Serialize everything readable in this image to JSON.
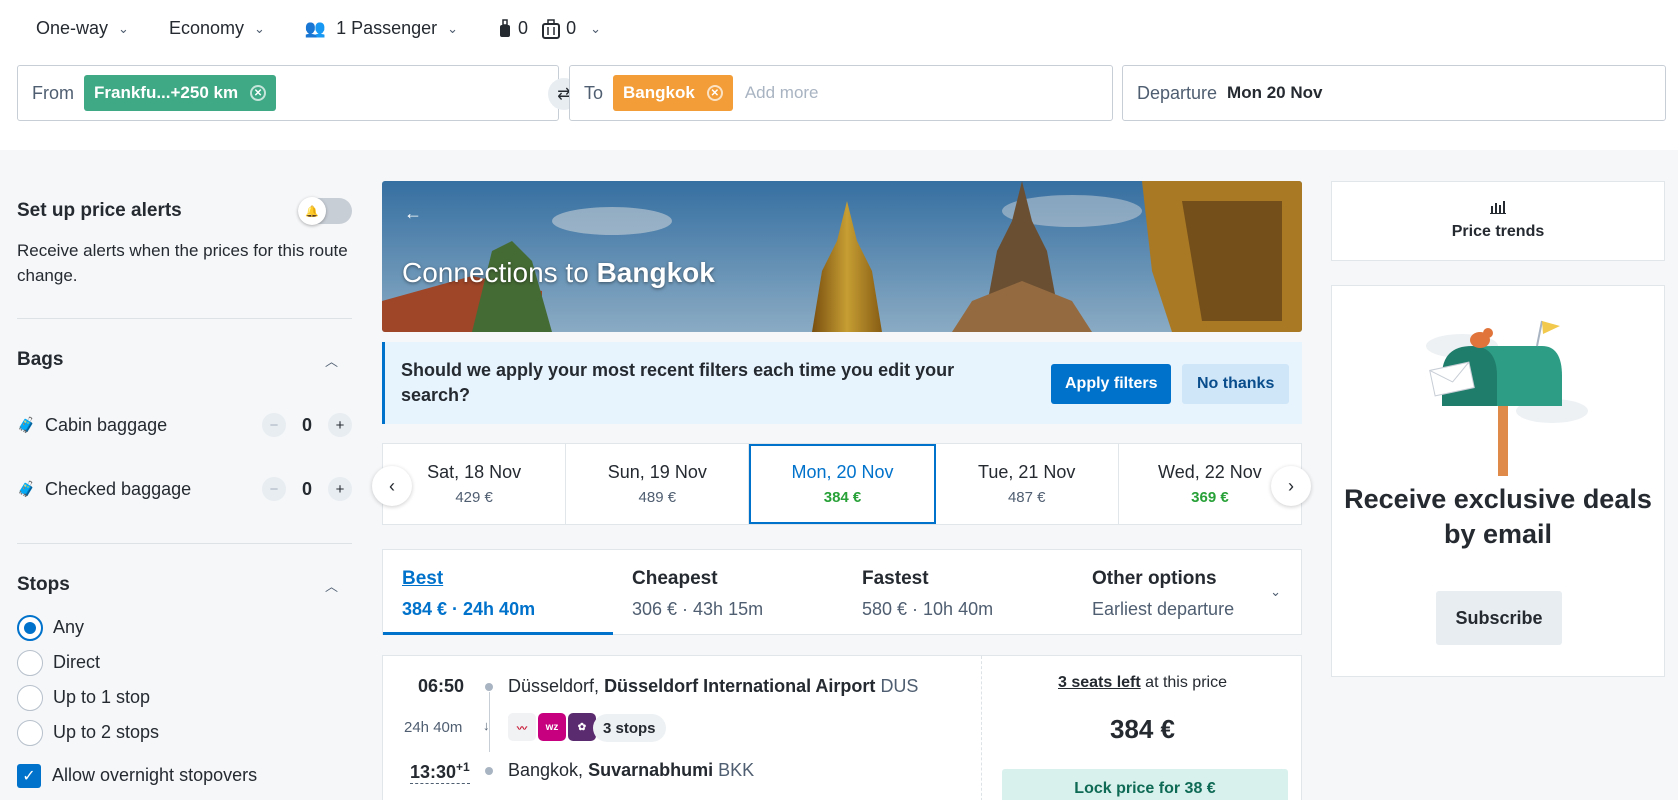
{
  "search": {
    "trip_type": "One-way",
    "cabin_class": "Economy",
    "passengers": "1 Passenger",
    "cabin_bags": "0",
    "checked_bags": "0",
    "from_label": "From",
    "from_chip": "Frankfu...+250 km",
    "to_label": "To",
    "to_chip": "Bangkok",
    "add_more": "Add more",
    "departure_label": "Departure",
    "departure_value": "Mon 20 Nov"
  },
  "sidebar": {
    "alerts_title": "Set up price alerts",
    "alerts_desc": "Receive alerts when the prices for this route change.",
    "bags_title": "Bags",
    "cabin_label": "Cabin baggage",
    "cabin_count": "0",
    "checked_label": "Checked baggage",
    "checked_count": "0",
    "stops_title": "Stops",
    "stops_options": [
      "Any",
      "Direct",
      "Up to 1 stop",
      "Up to 2 stops"
    ],
    "stops_selected": "Any",
    "overnight_label": "Allow overnight stopovers"
  },
  "banner": {
    "back": "←",
    "title_prefix": "Connections to",
    "title_city": "Bangkok"
  },
  "notice": {
    "question": "Should we apply your most recent filters each time you edit your search?",
    "apply": "Apply filters",
    "decline": "No thanks"
  },
  "dates": [
    {
      "day": "Sat, 18 Nov",
      "price": "429 €"
    },
    {
      "day": "Sun, 19 Nov",
      "price": "489 €"
    },
    {
      "day": "Mon, 20 Nov",
      "price": "384 €"
    },
    {
      "day": "Tue, 21 Nov",
      "price": "487 €"
    },
    {
      "day": "Wed, 22 Nov",
      "price": "369 €"
    }
  ],
  "sort": [
    {
      "title": "Best",
      "sub": "384 € · 24h 40m"
    },
    {
      "title": "Cheapest",
      "sub": "306 € · 43h 15m"
    },
    {
      "title": "Fastest",
      "sub": "580 € · 10h 40m"
    },
    {
      "title": "Other options",
      "sub": "Earliest departure"
    }
  ],
  "result": {
    "dep_time": "06:50",
    "dep_city": "Düsseldorf,",
    "dep_airport": "Düsseldorf International Airport",
    "dep_code": "DUS",
    "duration": "24h 40m",
    "stops": "3 stops",
    "arr_time": "13:30",
    "arr_plus": "+1",
    "arr_city": "Bangkok,",
    "arr_airport": "Suvarnabhumi",
    "arr_code": "BKK",
    "seats_strong": "3 seats left",
    "seats_rest": " at this price",
    "price": "384 €",
    "lock": "Lock price for 38 €"
  },
  "right": {
    "trends": "Price trends",
    "deals_title": "Receive exclusive deals by email",
    "subscribe": "Subscribe"
  },
  "colors": {
    "accent": "#0172cb",
    "from_chip": "#3fa885",
    "to_chip": "#f29d38",
    "good_price": "#28a138"
  }
}
